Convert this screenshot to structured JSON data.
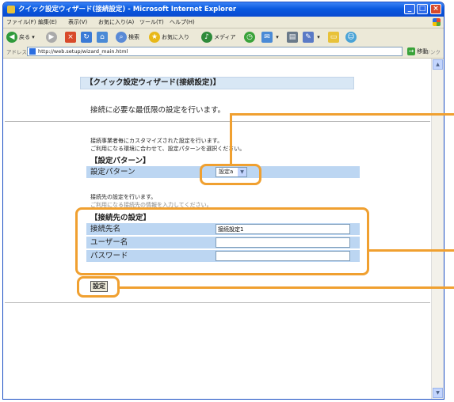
{
  "window": {
    "title": "クイック設定ウィザード(接続設定) - Microsoft Internet Explorer"
  },
  "menu": [
    "ファイル(F)",
    "編集(E)",
    "表示(V)",
    "お気に入り(A)",
    "ツール(T)",
    "ヘルプ(H)"
  ],
  "toolbar": {
    "back_label": "戻る",
    "search_label": "検索",
    "favorites_label": "お気に入り",
    "media_label": "メディア"
  },
  "address": {
    "label": "アドレス(D)",
    "url": "http://web.setup/wizard_main.html",
    "go_label": "移動",
    "links_label": "リンク"
  },
  "page": {
    "heading": "【クイック設定ウィザード(接続設定)】",
    "subtitle": "接続に必要な最低限の設定を行います。",
    "pattern_note_1": "接続事業者毎にカスタマイズされた設定を行います。",
    "pattern_note_2": "ご利用になる環境に合わせて、設定パターンを選択ください。",
    "pattern_section_title": "【設定パターン】",
    "pattern_label": "設定パターン",
    "pattern_value": "設定a",
    "dest_note_1": "接続先の設定を行います。",
    "dest_note_2": "ご利用になる接続先の情報を入力してください。",
    "dest_section_title": "【接続先の設定】",
    "fields": [
      {
        "label": "接続先名",
        "value": "接続設定1"
      },
      {
        "label": "ユーザー名",
        "value": ""
      },
      {
        "label": "パスワード",
        "value": ""
      }
    ],
    "submit_label": "設定"
  },
  "colors": {
    "titlebar": "#0a5ae0",
    "row_bg": "#bcd6f2",
    "callout": "#f0a030"
  }
}
